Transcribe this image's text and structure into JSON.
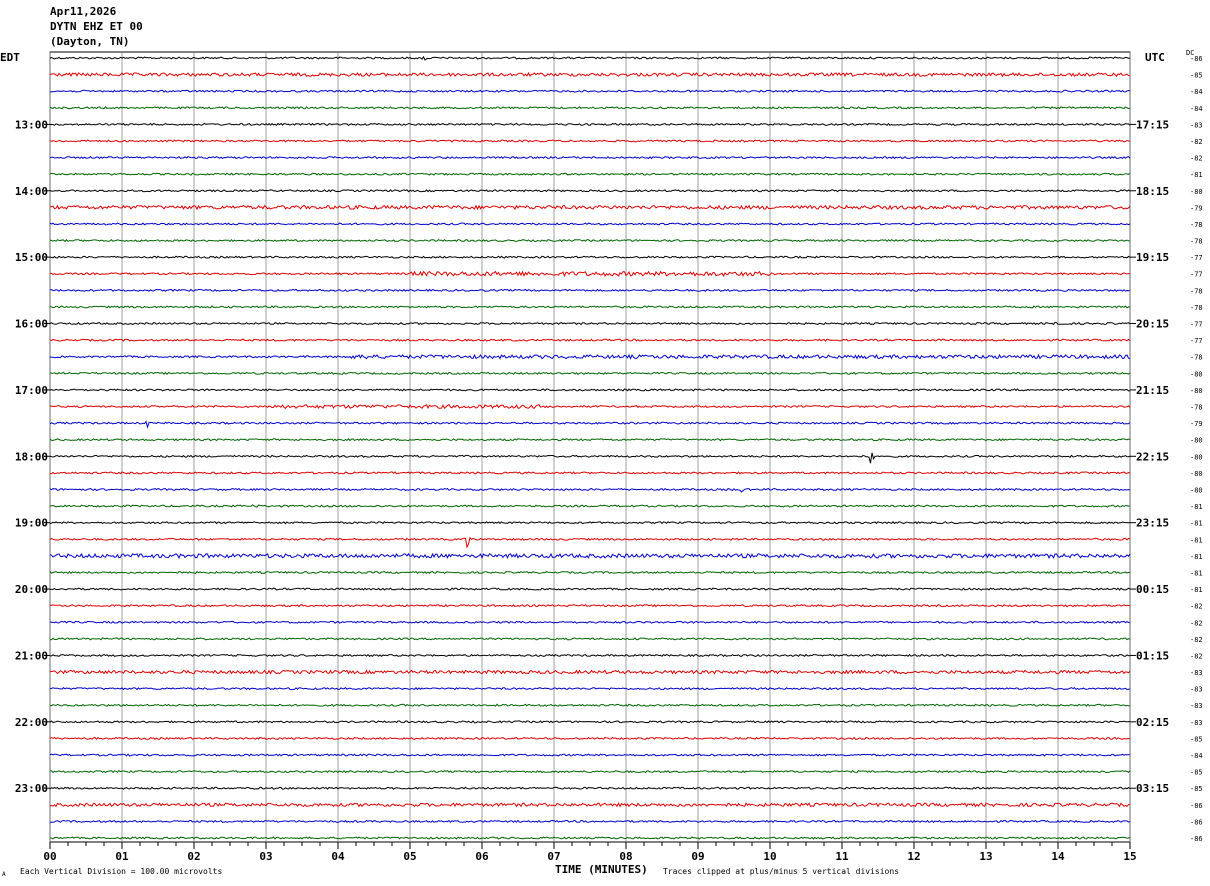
{
  "header": {
    "date": "Apr11,2026",
    "station": "DYTN EHZ ET 00",
    "location": "(Dayton, TN)",
    "left_tz": "EDT",
    "right_tz": "UTC",
    "dc_label": "DC"
  },
  "footer": {
    "scale_note": "Each Vertical Division = 100.00 microvolts",
    "xaxis_label": "TIME (MINUTES)",
    "clip_note": "Traces clipped at plus/minus 5 vertical divisions",
    "corner_mark": "A"
  },
  "colors": {
    "trace_cycle": [
      "#000000",
      "#dd0000",
      "#0000cc",
      "#006600"
    ],
    "grid": "#888888"
  },
  "chart_data": {
    "type": "line",
    "title": "DYTN EHZ ET 00",
    "xlabel": "TIME (MINUTES)",
    "x_ticks": [
      "00",
      "01",
      "02",
      "03",
      "04",
      "05",
      "06",
      "07",
      "08",
      "09",
      "10",
      "11",
      "12",
      "13",
      "14",
      "15"
    ],
    "xlim": [
      0,
      15
    ],
    "rows": 48,
    "minutes_per_row": 15,
    "left_hour_labels": [
      {
        "row": 4,
        "label": "13:00"
      },
      {
        "row": 8,
        "label": "14:00"
      },
      {
        "row": 12,
        "label": "15:00"
      },
      {
        "row": 16,
        "label": "16:00"
      },
      {
        "row": 20,
        "label": "17:00"
      },
      {
        "row": 24,
        "label": "18:00"
      },
      {
        "row": 28,
        "label": "19:00"
      },
      {
        "row": 32,
        "label": "20:00"
      },
      {
        "row": 36,
        "label": "21:00"
      },
      {
        "row": 40,
        "label": "22:00"
      },
      {
        "row": 44,
        "label": "23:00"
      }
    ],
    "right_hour_labels": [
      {
        "row": 4,
        "label": "17:15"
      },
      {
        "row": 8,
        "label": "18:15"
      },
      {
        "row": 12,
        "label": "19:15"
      },
      {
        "row": 16,
        "label": "20:15"
      },
      {
        "row": 20,
        "label": "21:15"
      },
      {
        "row": 24,
        "label": "22:15"
      },
      {
        "row": 28,
        "label": "23:15"
      },
      {
        "row": 32,
        "label": "00:15"
      },
      {
        "row": 36,
        "label": "01:15"
      },
      {
        "row": 40,
        "label": "02:15"
      },
      {
        "row": 44,
        "label": "03:15"
      }
    ],
    "dc_offsets": [
      "-86",
      "-85",
      "-84",
      "-84",
      "-83",
      "-82",
      "-82",
      "-81",
      "-80",
      "-79",
      "-78",
      "-78",
      "-77",
      "-77",
      "-78",
      "-78",
      "-77",
      "-77",
      "-78",
      "-80",
      "-80",
      "-78",
      "-79",
      "-80",
      "-80",
      "-80",
      "-80",
      "-81",
      "-81",
      "-81",
      "-81",
      "-81",
      "-81",
      "-82",
      "-82",
      "-82",
      "-82",
      "-83",
      "-83",
      "-83",
      "-83",
      "-85",
      "-84",
      "-85",
      "-85",
      "-86",
      "-86",
      "-86"
    ],
    "events": [
      {
        "row": 0,
        "minute": 5.2,
        "amp": 4
      },
      {
        "row": 16,
        "minute": 14.0,
        "amp": 6
      },
      {
        "row": 18,
        "minute": 4.4,
        "amp": 3
      },
      {
        "row": 22,
        "minute": 1.35,
        "amp": 5
      },
      {
        "row": 22,
        "minute": 8.8,
        "amp": 3
      },
      {
        "row": 24,
        "minute": 11.4,
        "amp": 8
      },
      {
        "row": 25,
        "minute": 4.75,
        "amp": 3
      },
      {
        "row": 26,
        "minute": 9.6,
        "amp": 3
      },
      {
        "row": 27,
        "minute": 2.85,
        "amp": 5
      },
      {
        "row": 29,
        "minute": 5.8,
        "amp": 9
      },
      {
        "row": 30,
        "minute": 6.0,
        "amp": 3
      },
      {
        "row": 36,
        "minute": 10.8,
        "amp": 3
      }
    ],
    "noisy_segments": [
      {
        "row": 1,
        "from": 0,
        "to": 15,
        "amp": 1.6
      },
      {
        "row": 9,
        "from": 0,
        "to": 15,
        "amp": 1.8
      },
      {
        "row": 13,
        "from": 5,
        "to": 10,
        "amp": 2.2
      },
      {
        "row": 18,
        "from": 4,
        "to": 15,
        "amp": 1.8
      },
      {
        "row": 21,
        "from": 3,
        "to": 7,
        "amp": 1.8
      },
      {
        "row": 30,
        "from": 0,
        "to": 15,
        "amp": 2.0
      },
      {
        "row": 37,
        "from": 0,
        "to": 15,
        "amp": 1.6
      },
      {
        "row": 45,
        "from": 0,
        "to": 15,
        "amp": 1.6
      }
    ]
  }
}
